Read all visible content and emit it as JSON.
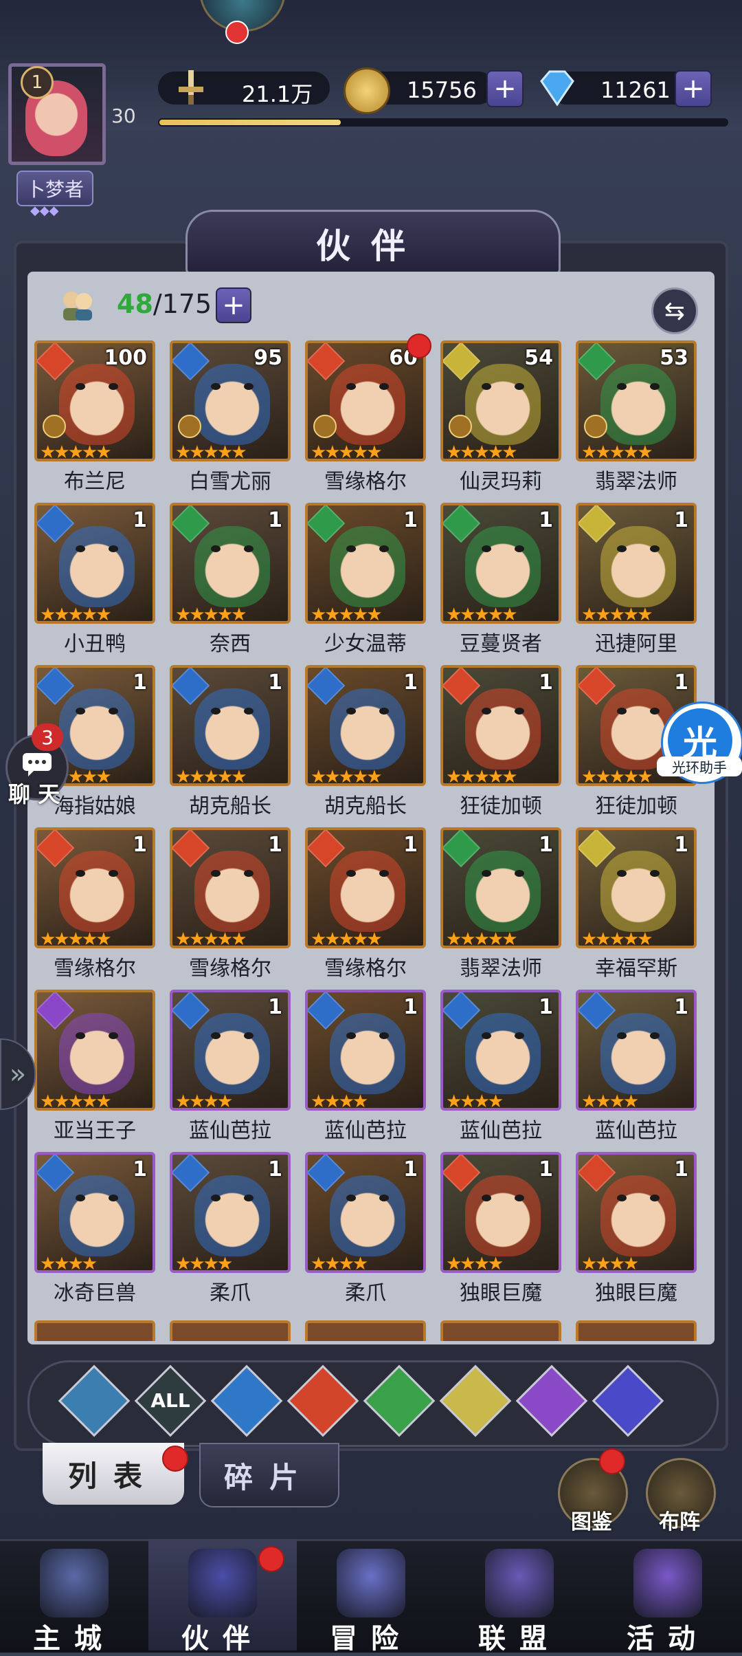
{
  "player": {
    "level": "1",
    "exp_level": "30",
    "title": "卜梦者",
    "title_gems": "◆◆◆",
    "power": "21.1万",
    "gold": "15756",
    "diamonds": "11261",
    "exp_progress": 0.32
  },
  "panel": {
    "title": "伙伴",
    "count_current": "48",
    "count_total": "/175"
  },
  "heroes": [
    {
      "name": "布兰尼",
      "level": "100",
      "element": "fire",
      "stars": "★★★★★",
      "crown": true,
      "frame": "gold"
    },
    {
      "name": "白雪尤丽",
      "level": "95",
      "element": "water",
      "stars": "★★★★★",
      "crown": true,
      "frame": "gold"
    },
    {
      "name": "雪缘格尔",
      "level": "60",
      "element": "fire",
      "stars": "★★★★★",
      "crown": true,
      "frame": "gold",
      "dot": true
    },
    {
      "name": "仙灵玛莉",
      "level": "54",
      "element": "light",
      "stars": "★★★★★",
      "crown": true,
      "frame": "gold"
    },
    {
      "name": "翡翠法师",
      "level": "53",
      "element": "wind",
      "stars": "★★★★★",
      "crown": true,
      "frame": "gold"
    },
    {
      "name": "小丑鸭",
      "level": "1",
      "element": "water",
      "stars": "★★★★★",
      "frame": "gold"
    },
    {
      "name": "奈西",
      "level": "1",
      "element": "wind",
      "stars": "★★★★★",
      "frame": "gold"
    },
    {
      "name": "少女温蒂",
      "level": "1",
      "element": "wind",
      "stars": "★★★★★",
      "frame": "gold"
    },
    {
      "name": "豆蔓贤者",
      "level": "1",
      "element": "wind",
      "stars": "★★★★★",
      "frame": "gold"
    },
    {
      "name": "迅捷阿里",
      "level": "1",
      "element": "light",
      "stars": "★★★★★",
      "frame": "gold"
    },
    {
      "name": "海指姑娘",
      "level": "1",
      "element": "water",
      "stars": "★★★★★",
      "frame": "gold"
    },
    {
      "name": "胡克船长",
      "level": "1",
      "element": "water",
      "stars": "★★★★★",
      "frame": "gold"
    },
    {
      "name": "胡克船长",
      "level": "1",
      "element": "water",
      "stars": "★★★★★",
      "frame": "gold"
    },
    {
      "name": "狂徒加顿",
      "level": "1",
      "element": "fire",
      "stars": "★★★★★",
      "frame": "gold"
    },
    {
      "name": "狂徒加顿",
      "level": "1",
      "element": "fire",
      "stars": "★★★★★",
      "frame": "gold"
    },
    {
      "name": "雪缘格尔",
      "level": "1",
      "element": "fire",
      "stars": "★★★★★",
      "frame": "gold"
    },
    {
      "name": "雪缘格尔",
      "level": "1",
      "element": "fire",
      "stars": "★★★★★",
      "frame": "gold"
    },
    {
      "name": "雪缘格尔",
      "level": "1",
      "element": "fire",
      "stars": "★★★★★",
      "frame": "gold"
    },
    {
      "name": "翡翠法师",
      "level": "1",
      "element": "wind",
      "stars": "★★★★★",
      "frame": "gold"
    },
    {
      "name": "幸福罕斯",
      "level": "1",
      "element": "light",
      "stars": "★★★★★",
      "frame": "gold"
    },
    {
      "name": "亚当王子",
      "level": "",
      "element": "dark",
      "stars": "★★★★★",
      "frame": "gold"
    },
    {
      "name": "蓝仙芭拉",
      "level": "1",
      "element": "water",
      "stars": "★★★★",
      "frame": "purple"
    },
    {
      "name": "蓝仙芭拉",
      "level": "1",
      "element": "water",
      "stars": "★★★★",
      "frame": "purple"
    },
    {
      "name": "蓝仙芭拉",
      "level": "1",
      "element": "water",
      "stars": "★★★★",
      "frame": "purple"
    },
    {
      "name": "蓝仙芭拉",
      "level": "1",
      "element": "water",
      "stars": "★★★★",
      "frame": "purple"
    },
    {
      "name": "冰奇巨兽",
      "level": "1",
      "element": "water",
      "stars": "★★★★",
      "frame": "purple"
    },
    {
      "name": "柔爪",
      "level": "1",
      "element": "water",
      "stars": "★★★★",
      "frame": "purple"
    },
    {
      "name": "柔爪",
      "level": "1",
      "element": "water",
      "stars": "★★★★",
      "frame": "purple"
    },
    {
      "name": "独眼巨魔",
      "level": "1",
      "element": "fire",
      "stars": "★★★★",
      "frame": "purple"
    },
    {
      "name": "独眼巨魔",
      "level": "1",
      "element": "fire",
      "stars": "★★★★",
      "frame": "purple"
    }
  ],
  "filters": [
    {
      "name": "filter-all-elements-icon",
      "label": "",
      "color": "#3a7fb0"
    },
    {
      "name": "filter-all",
      "label": "ALL",
      "color": "#2e3c40"
    },
    {
      "name": "filter-water-icon",
      "label": "",
      "color": "#2f78c8"
    },
    {
      "name": "filter-fire-icon",
      "label": "",
      "color": "#d2452a"
    },
    {
      "name": "filter-wind-icon",
      "label": "",
      "color": "#3aa04a"
    },
    {
      "name": "filter-light-icon",
      "label": "",
      "color": "#c9b84a"
    },
    {
      "name": "filter-dark-icon",
      "label": "",
      "color": "#8a4ac8"
    },
    {
      "name": "filter-cosmic-icon",
      "label": "",
      "color": "#4a4ac8"
    }
  ],
  "side": {
    "chat_label": "聊 天",
    "chat_badge": "3",
    "helper_icon": "光",
    "helper_label": "光环助手",
    "side_arrow": "»"
  },
  "tabs": {
    "list": "列表",
    "fragments": "碎片",
    "codex": "图鉴",
    "formation": "布阵"
  },
  "nav": [
    {
      "label": "主城",
      "icon": "castle-icon",
      "color": "#5a6aa8"
    },
    {
      "label": "伙伴",
      "icon": "wizard-hat-icon",
      "color": "#4b4ea8",
      "active": true,
      "dot": true
    },
    {
      "label": "冒险",
      "icon": "compass-icon",
      "color": "#6a70c8"
    },
    {
      "label": "联盟",
      "icon": "shield-icon",
      "color": "#6a5ab8"
    },
    {
      "label": "活动",
      "icon": "cards-icon",
      "color": "#7a58c8"
    }
  ],
  "colors": {
    "fire": "#d8462a",
    "water": "#2f6ec8",
    "wind": "#2f9a4a",
    "light": "#c9b43a",
    "dark": "#8a48c8"
  }
}
